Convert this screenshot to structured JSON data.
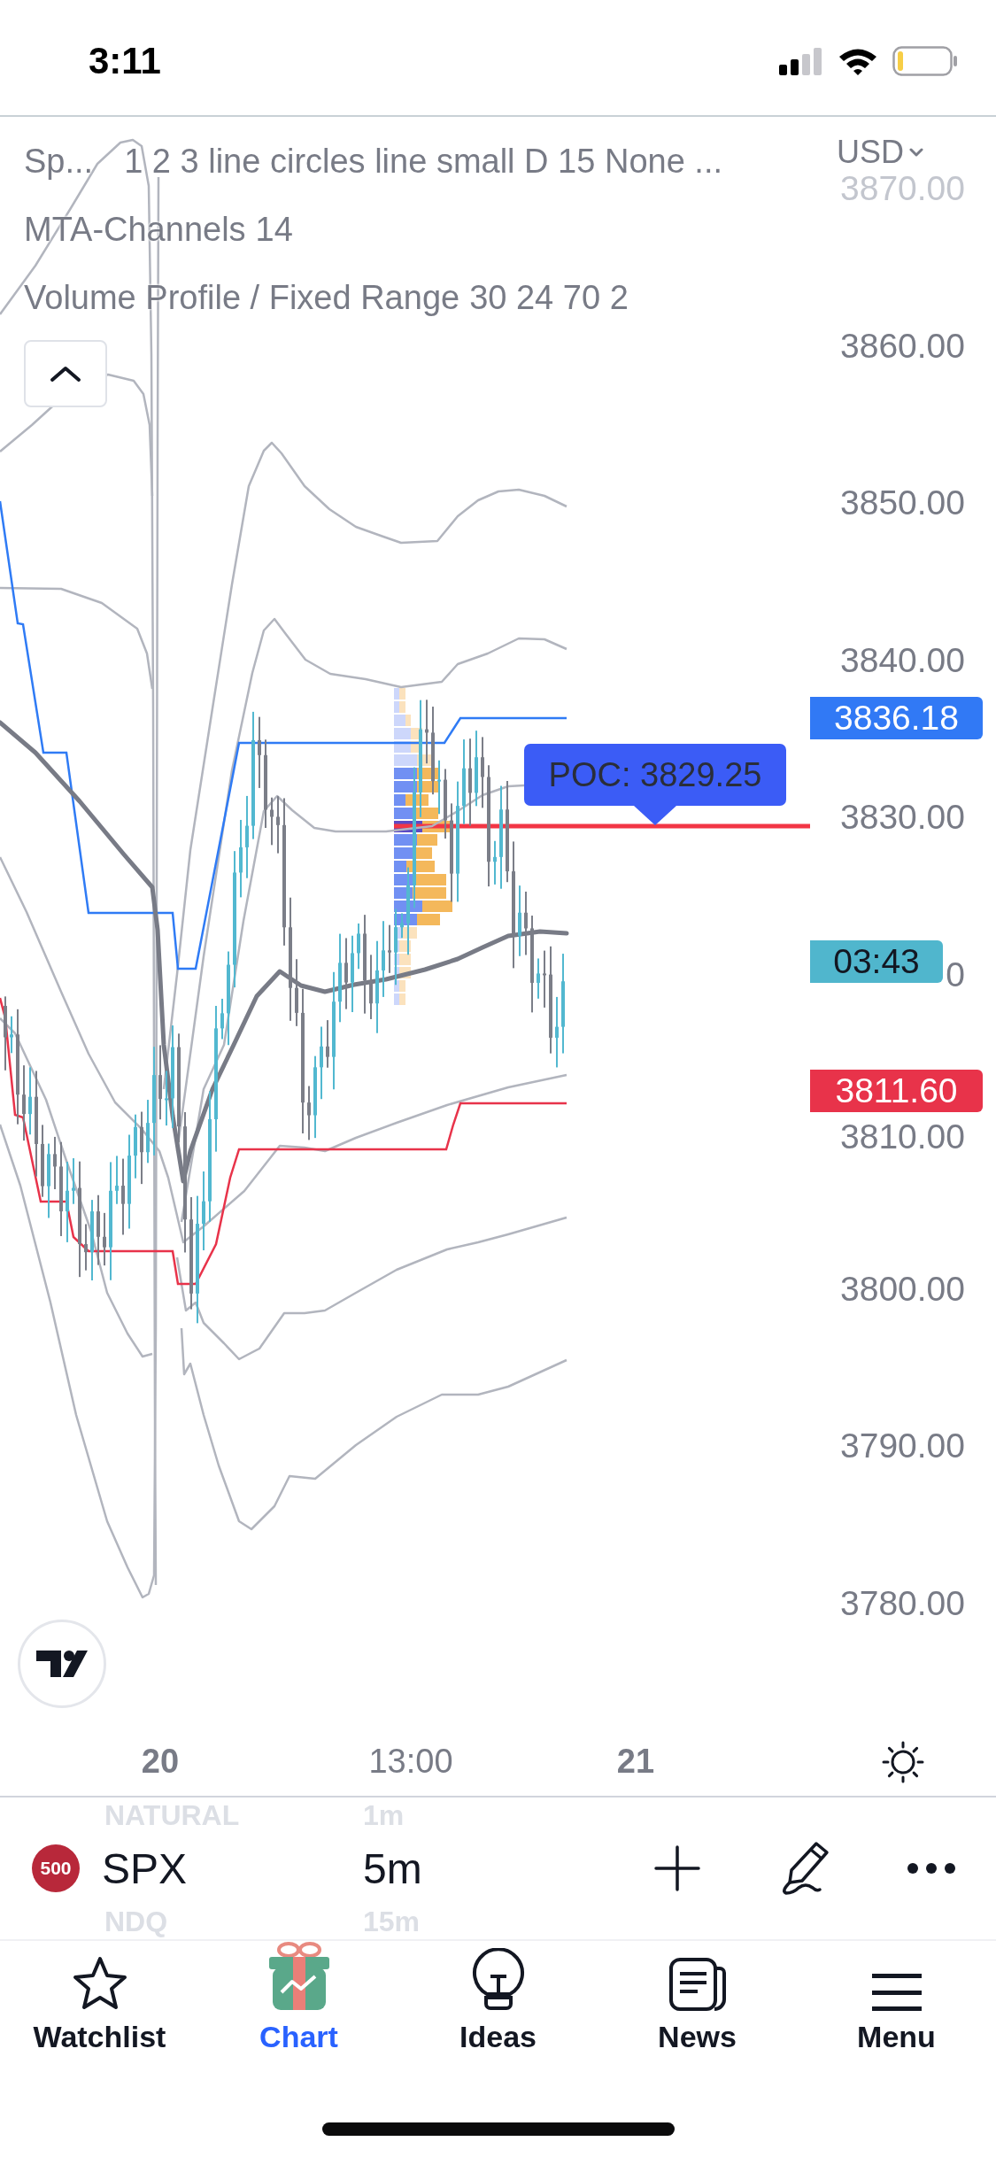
{
  "status_bar": {
    "time": "3:11"
  },
  "legend": {
    "expanded": true,
    "indicators": [
      {
        "name": "Sp...",
        "values": "1 2 3 line circles line small D 15 None ..."
      },
      {
        "name": "MTA-Channels",
        "values": "14"
      },
      {
        "name": "Volume Profile / Fixed Range",
        "values": "30 24 70 2"
      }
    ]
  },
  "price_axis": {
    "currency": "USD",
    "labels": [
      "3870.00",
      "3860.00",
      "3850.00",
      "3840.00",
      "3830.00",
      "0",
      "3810.00",
      "3800.00",
      "3790.00",
      "3780.00"
    ]
  },
  "price_badges": [
    {
      "kind": "price",
      "text": "3836.18",
      "color": "#3179f5"
    },
    {
      "kind": "countdown",
      "text": "03:43",
      "color": "#50b6cd"
    },
    {
      "kind": "price",
      "text": "3811.60",
      "color": "#e8334a"
    }
  ],
  "poc_label": {
    "text": "POC: 3829.25"
  },
  "time_axis": {
    "labels": [
      {
        "kind": "day",
        "text": "20"
      },
      {
        "kind": "time",
        "text": "13:00"
      },
      {
        "kind": "day",
        "text": "21"
      }
    ]
  },
  "symbol_bar": {
    "badge": "500",
    "symbol": "SPX",
    "interval": "5m",
    "picker_above": {
      "symbol": "NATURAL",
      "interval": "1m"
    },
    "picker_below": {
      "symbol": "NDQ",
      "interval": "15m"
    }
  },
  "tabs": [
    {
      "label": "Watchlist",
      "selected": false
    },
    {
      "label": "Chart",
      "selected": true
    },
    {
      "label": "Ideas",
      "selected": false
    },
    {
      "label": "News",
      "selected": false
    },
    {
      "label": "Menu",
      "selected": false
    }
  ]
}
